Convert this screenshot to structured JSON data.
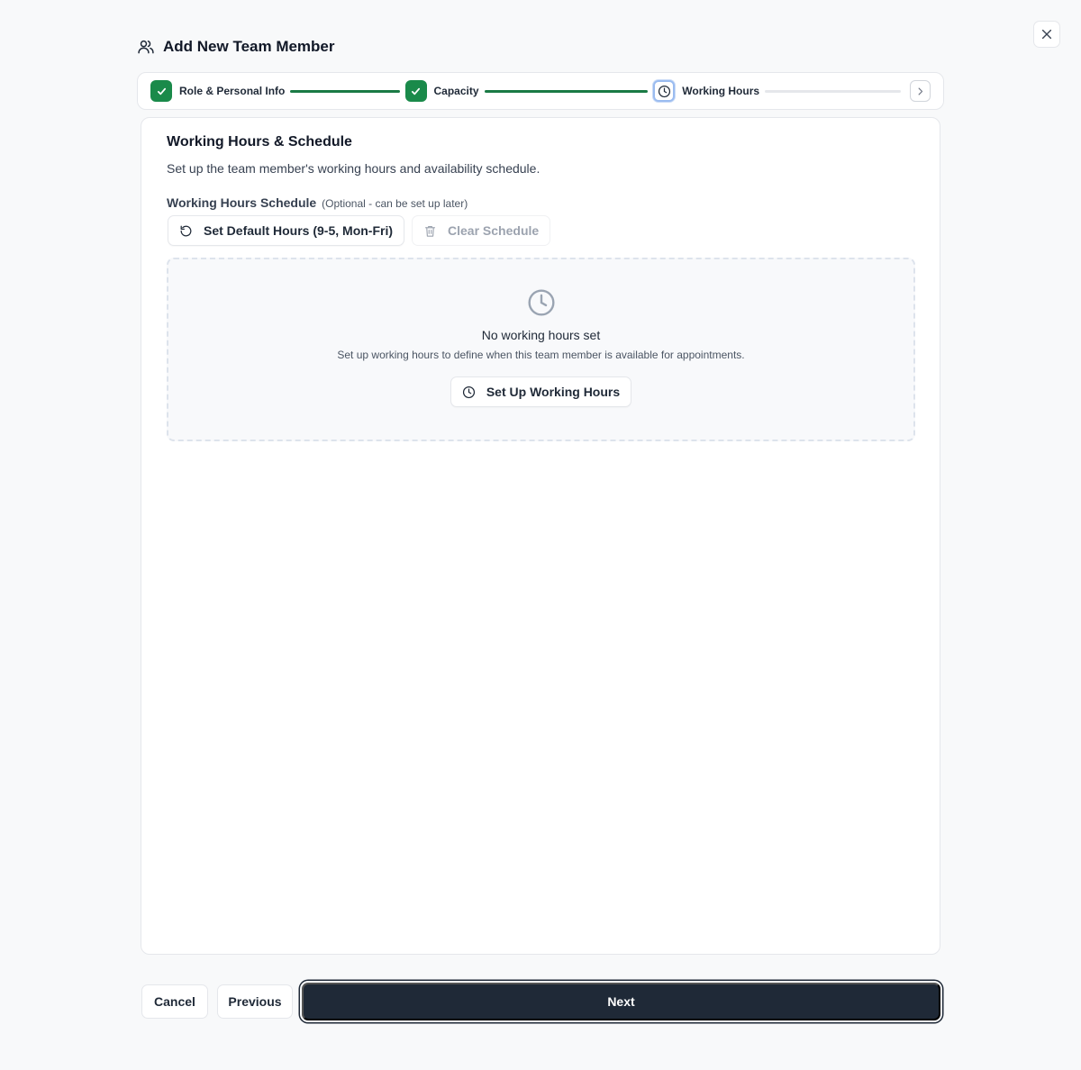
{
  "dialog": {
    "title": "Add New Team Member",
    "close_icon": "close-icon",
    "header_icon": "users-icon"
  },
  "stepper": {
    "steps": [
      {
        "label": "Role & Personal Info",
        "status": "complete",
        "icon": "check-icon"
      },
      {
        "label": "Capacity",
        "status": "complete",
        "icon": "check-icon"
      },
      {
        "label": "Working Hours",
        "status": "current",
        "icon": "clock-icon"
      }
    ],
    "next_icon": "chevron-right-icon",
    "colors": {
      "complete": "#1a8a4a",
      "current_ring": "#9bbcf0",
      "pending_line": "#e5e7eb"
    }
  },
  "section": {
    "title": "Working Hours & Schedule",
    "description": "Set up the team member's working hours and availability schedule.",
    "schedule_label": "Working Hours Schedule",
    "schedule_optional": "(Optional - can be set up later)",
    "default_button": "Set Default Hours (9-5, Mon-Fri)",
    "clear_button": "Clear Schedule"
  },
  "empty_state": {
    "icon": "clock-icon",
    "title": "No working hours set",
    "description": "Set up working hours to define when this team member is available for appointments.",
    "button": "Set Up Working Hours"
  },
  "footer": {
    "cancel": "Cancel",
    "previous": "Previous",
    "next": "Next"
  }
}
